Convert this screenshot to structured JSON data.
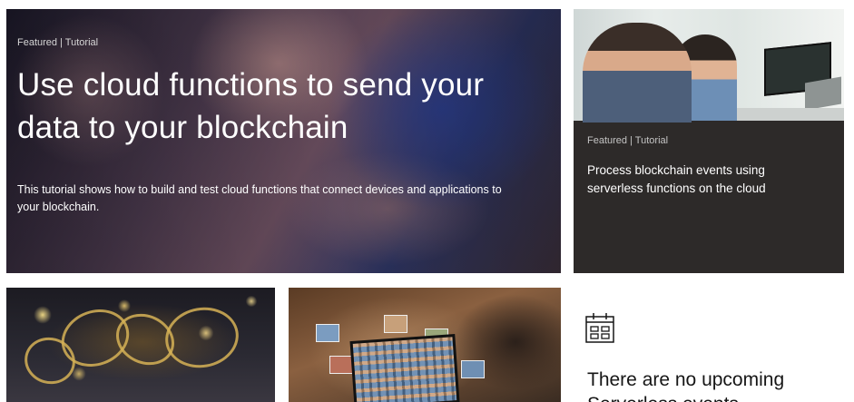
{
  "hero": {
    "tag": "Featured | Tutorial",
    "title": "Use cloud functions to send your data to your blockchain",
    "description": "This tutorial shows how to build and test cloud functions that connect devices and applications to your blockchain."
  },
  "card2": {
    "tag": "Featured | Tutorial",
    "title": "Process blockchain events using serverless functions on the cloud"
  },
  "events": {
    "icon": "calendar-icon",
    "message": "There are no upcoming Serverless events"
  },
  "colors": {
    "dark_card": "#2d2a29",
    "text_primary": "#161616"
  }
}
